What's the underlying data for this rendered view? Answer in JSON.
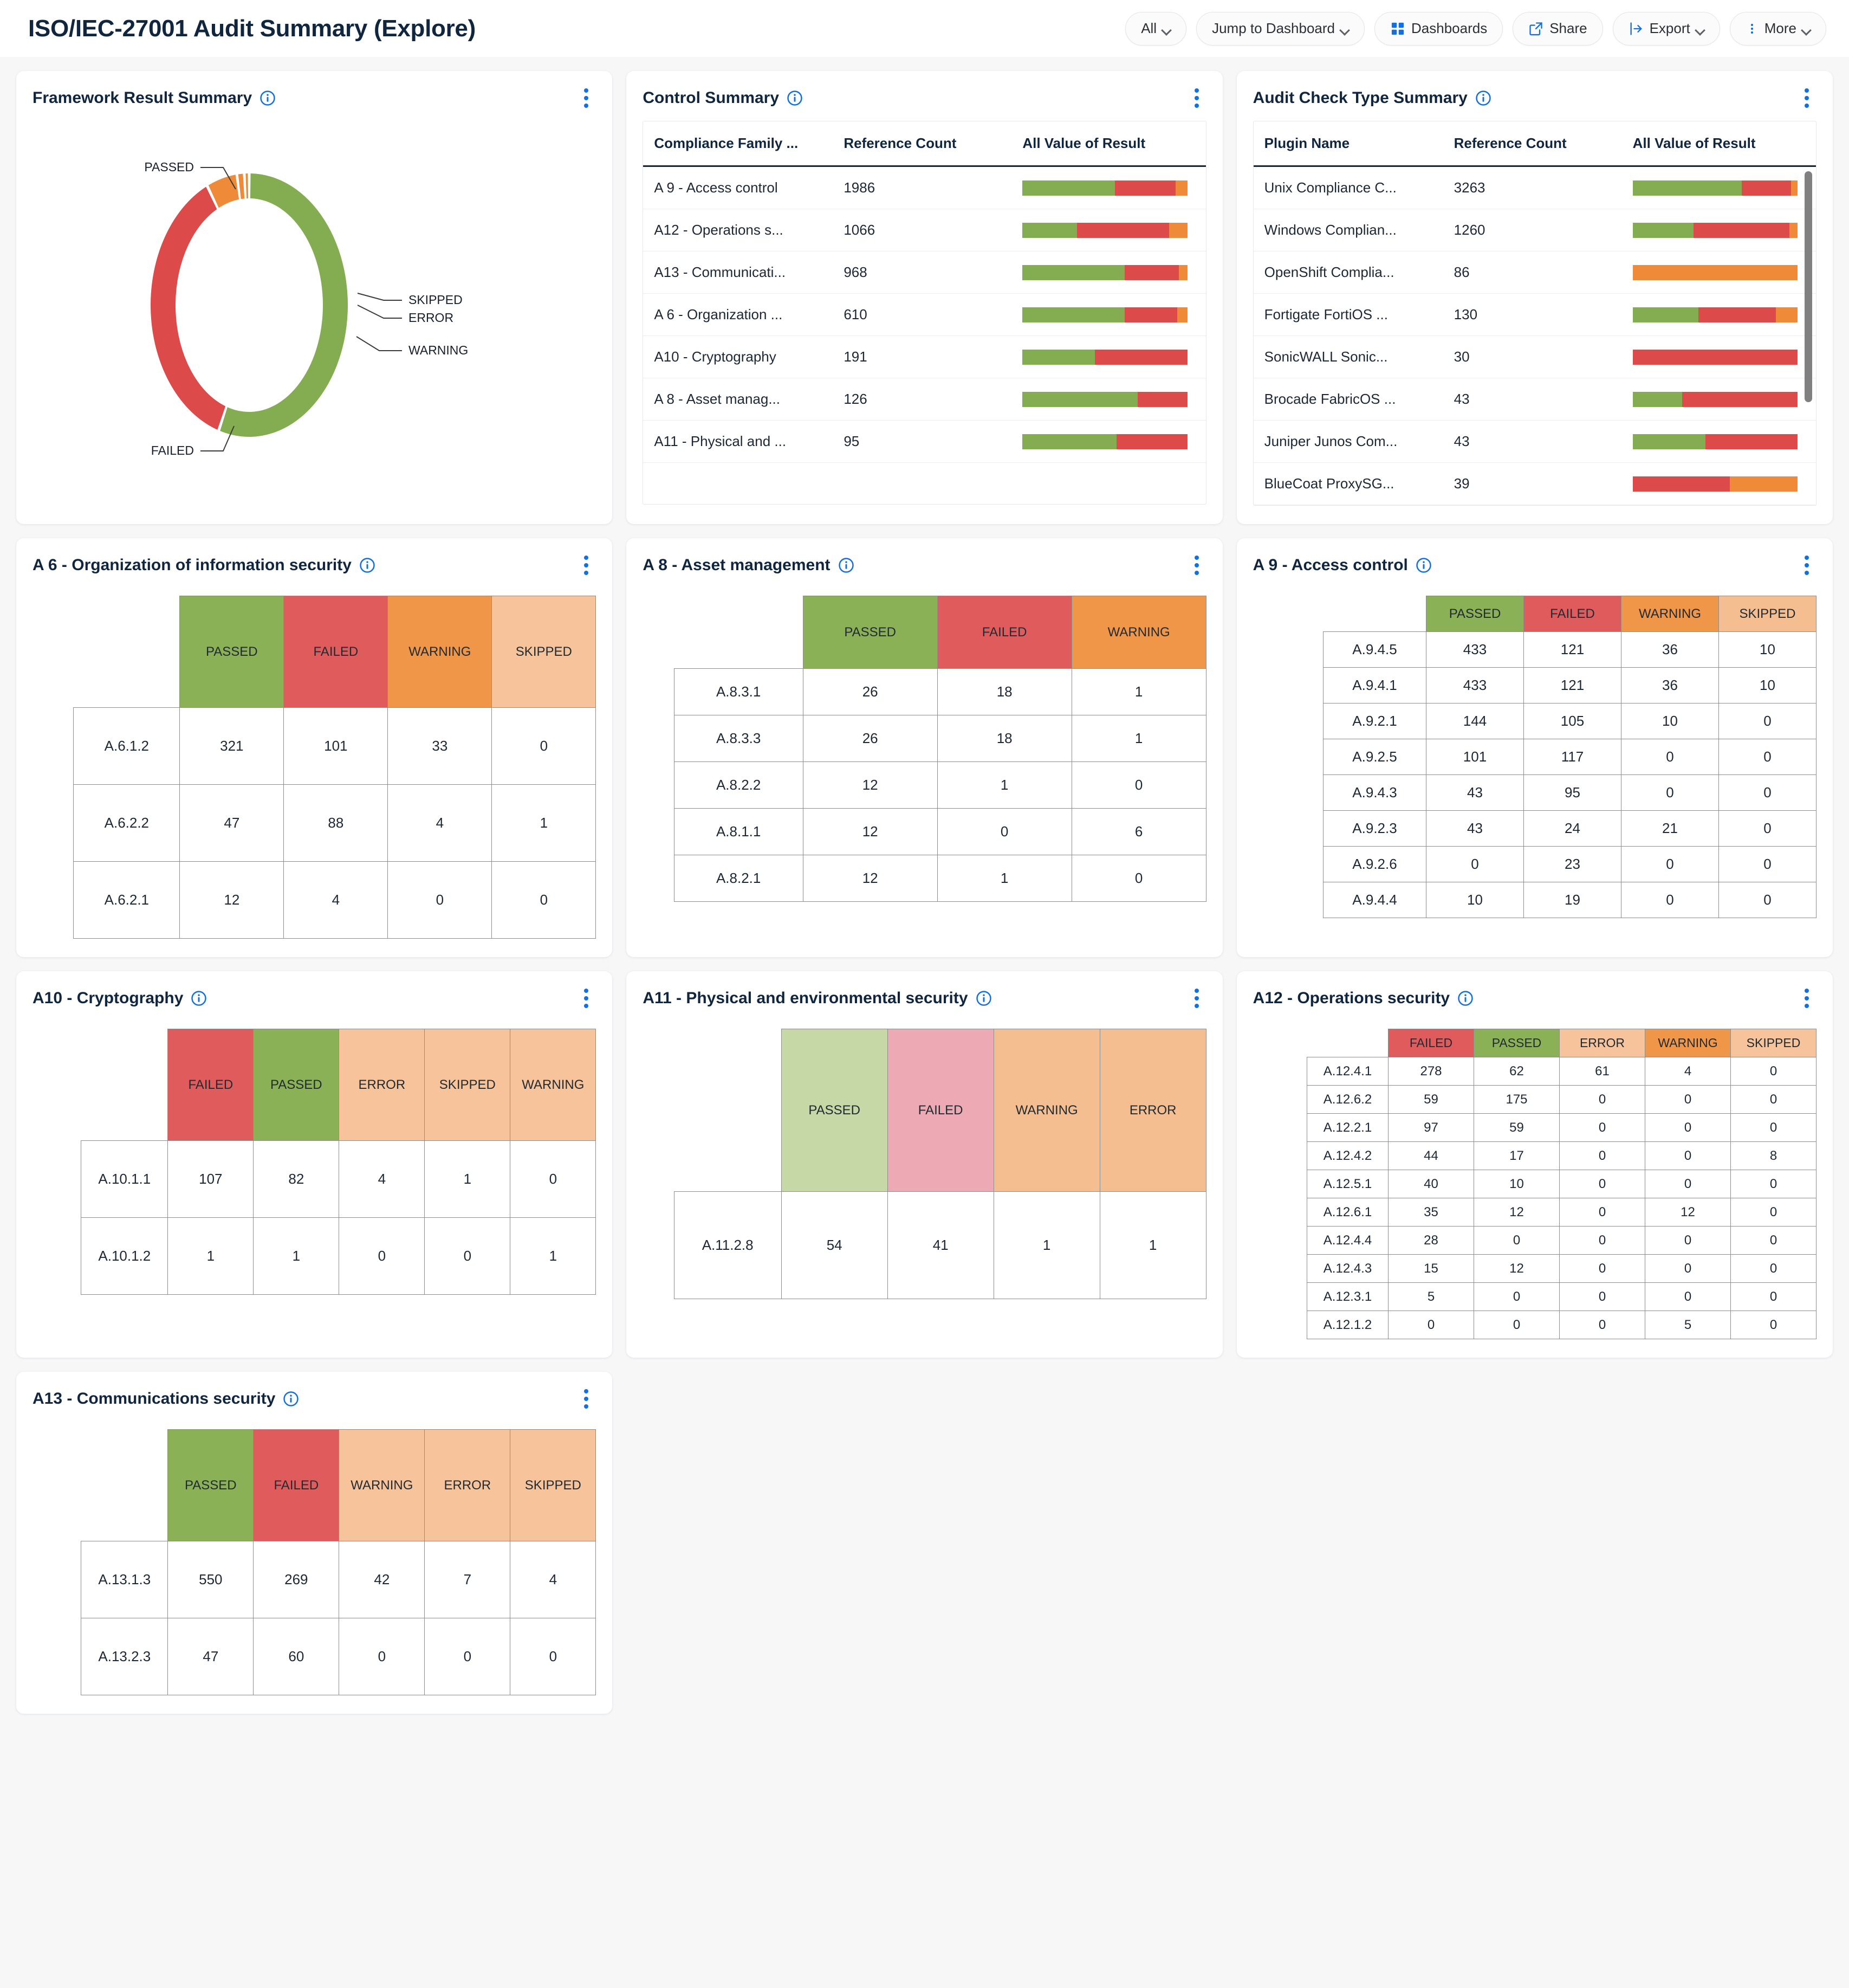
{
  "header": {
    "title": "ISO/IEC-27001 Audit Summary (Explore)",
    "buttons": [
      {
        "label": "All",
        "icon": "",
        "caret": true,
        "name": "filter-all-button"
      },
      {
        "label": "Jump to Dashboard",
        "icon": "",
        "caret": true,
        "name": "jump-to-dashboard-button"
      },
      {
        "label": "Dashboards",
        "icon": "grid-icon",
        "caret": false,
        "name": "dashboards-button"
      },
      {
        "label": "Share",
        "icon": "share-icon",
        "caret": false,
        "name": "share-button"
      },
      {
        "label": "Export",
        "icon": "export-icon",
        "caret": true,
        "name": "export-button"
      },
      {
        "label": "More",
        "icon": "kebab-icon",
        "caret": true,
        "name": "more-button"
      }
    ]
  },
  "colors": {
    "passed": "#84ad51",
    "failed": "#dc4a4a",
    "warning": "#ef8b38",
    "skipped": "#f7c39a",
    "error": "#f7c39a",
    "accent": "#1271e0",
    "title": "#10263f"
  },
  "cards": {
    "framework": {
      "title": "Framework Result Summary"
    },
    "control": {
      "title": "Control Summary"
    },
    "audit": {
      "title": "Audit Check Type Summary"
    },
    "a6": {
      "title": "A 6 - Organization of information security"
    },
    "a8": {
      "title": "A 8 - Asset management"
    },
    "a9": {
      "title": "A 9 - Access control"
    },
    "a10": {
      "title": "A10 - Cryptography"
    },
    "a11": {
      "title": "A11 - Physical and environmental security"
    },
    "a12": {
      "title": "A12 - Operations security"
    },
    "a13": {
      "title": "A13 - Communications security"
    }
  },
  "chart_data": [
    {
      "id": "framework_result_summary",
      "type": "pie",
      "title": "Framework Result Summary",
      "subtype": "donut",
      "labels": [
        "PASSED",
        "FAILED",
        "WARNING",
        "ERROR",
        "SKIPPED"
      ],
      "values": [
        55.0,
        38.0,
        5.0,
        1.2,
        0.8
      ],
      "unit": "percent",
      "colors": [
        "#84ad51",
        "#dc4a4a",
        "#ef8b38",
        "#ef8b38",
        "#ef8b38"
      ],
      "legend": "callout-labels",
      "grid": false
    },
    {
      "id": "control_summary",
      "type": "table",
      "title": "Control Summary",
      "columns": [
        "Compliance Family ...",
        "Reference Count",
        "All Value of Result"
      ],
      "rows": [
        {
          "name": "A 9 - Access control",
          "count": "1986",
          "bar": [
            {
              "k": "pass",
              "w": 56
            },
            {
              "k": "fail",
              "w": 37
            },
            {
              "k": "warn",
              "w": 7
            }
          ]
        },
        {
          "name": "A12 - Operations s...",
          "count": "1066",
          "bar": [
            {
              "k": "pass",
              "w": 33
            },
            {
              "k": "fail",
              "w": 56
            },
            {
              "k": "warn",
              "w": 11
            }
          ]
        },
        {
          "name": "A13 - Communicati...",
          "count": "968",
          "bar": [
            {
              "k": "pass",
              "w": 62
            },
            {
              "k": "fail",
              "w": 33
            },
            {
              "k": "warn",
              "w": 5
            }
          ]
        },
        {
          "name": "A 6 - Organization ...",
          "count": "610",
          "bar": [
            {
              "k": "pass",
              "w": 62
            },
            {
              "k": "fail",
              "w": 32
            },
            {
              "k": "warn",
              "w": 6
            }
          ]
        },
        {
          "name": "A10 - Cryptography",
          "count": "191",
          "bar": [
            {
              "k": "pass",
              "w": 44
            },
            {
              "k": "fail",
              "w": 56
            }
          ]
        },
        {
          "name": "A 8 - Asset manag...",
          "count": "126",
          "bar": [
            {
              "k": "pass",
              "w": 70
            },
            {
              "k": "fail",
              "w": 30
            }
          ]
        },
        {
          "name": "A11 - Physical and ...",
          "count": "95",
          "bar": [
            {
              "k": "pass",
              "w": 57
            },
            {
              "k": "fail",
              "w": 43
            }
          ]
        }
      ]
    },
    {
      "id": "audit_check_type_summary",
      "type": "table",
      "title": "Audit Check Type Summary",
      "columns": [
        "Plugin Name",
        "Reference Count",
        "All Value of Result"
      ],
      "scrollbar": true,
      "rows": [
        {
          "name": "Unix Compliance C...",
          "count": "3263",
          "bar": [
            {
              "k": "pass",
              "w": 66
            },
            {
              "k": "fail",
              "w": 30
            },
            {
              "k": "warn",
              "w": 4
            }
          ]
        },
        {
          "name": "Windows Complian...",
          "count": "1260",
          "bar": [
            {
              "k": "pass",
              "w": 37
            },
            {
              "k": "fail",
              "w": 58
            },
            {
              "k": "warn",
              "w": 5
            }
          ]
        },
        {
          "name": "OpenShift Complia...",
          "count": "86",
          "bar": [
            {
              "k": "warn",
              "w": 100
            }
          ]
        },
        {
          "name": "Fortigate FortiOS ...",
          "count": "130",
          "bar": [
            {
              "k": "pass",
              "w": 40
            },
            {
              "k": "fail",
              "w": 47
            },
            {
              "k": "warn",
              "w": 13
            }
          ]
        },
        {
          "name": "SonicWALL Sonic...",
          "count": "30",
          "bar": [
            {
              "k": "fail",
              "w": 100
            }
          ]
        },
        {
          "name": "Brocade FabricOS ...",
          "count": "43",
          "bar": [
            {
              "k": "pass",
              "w": 30
            },
            {
              "k": "fail",
              "w": 70
            }
          ]
        },
        {
          "name": "Juniper Junos Com...",
          "count": "43",
          "bar": [
            {
              "k": "pass",
              "w": 44
            },
            {
              "k": "fail",
              "w": 56
            }
          ]
        },
        {
          "name": "BlueCoat ProxySG...",
          "count": "39",
          "bar": [
            {
              "k": "fail",
              "w": 59
            },
            {
              "k": "warn",
              "w": 41
            }
          ]
        }
      ]
    },
    {
      "id": "a6_organization_of_information_security",
      "type": "heatmap",
      "title": "A 6 - Organization of information security",
      "columns": [
        "PASSED",
        "FAILED",
        "WARNING",
        "SKIPPED"
      ],
      "column_styles": [
        "h-pass",
        "h-fail",
        "h-warn",
        "h-skip"
      ],
      "rows": [
        "A.6.1.2",
        "A.6.2.2",
        "A.6.2.1"
      ],
      "values": [
        [
          321,
          101,
          33,
          0
        ],
        [
          47,
          88,
          4,
          1
        ],
        [
          12,
          4,
          0,
          0
        ]
      ],
      "density": "roomy"
    },
    {
      "id": "a8_asset_management",
      "type": "heatmap",
      "title": "A 8 - Asset management",
      "columns": [
        "PASSED",
        "FAILED",
        "WARNING"
      ],
      "column_styles": [
        "h-pass",
        "h-fail",
        "h-warn"
      ],
      "rows": [
        "A.8.3.1",
        "A.8.3.3",
        "A.8.2.2",
        "A.8.1.1",
        "A.8.2.1"
      ],
      "values": [
        [
          26,
          18,
          1
        ],
        [
          26,
          18,
          1
        ],
        [
          12,
          1,
          0
        ],
        [
          12,
          0,
          6
        ],
        [
          12,
          1,
          0
        ]
      ],
      "density": "normal"
    },
    {
      "id": "a9_access_control",
      "type": "heatmap",
      "title": "A 9 - Access control",
      "columns": [
        "PASSED",
        "FAILED",
        "WARNING",
        "SKIPPED"
      ],
      "column_styles": [
        "h-pass",
        "h-fail",
        "h-warn",
        "h-warn-soft"
      ],
      "rows": [
        "A.9.4.5",
        "A.9.4.1",
        "A.9.2.1",
        "A.9.2.5",
        "A.9.4.3",
        "A.9.2.3",
        "A.9.2.6",
        "A.9.4.4"
      ],
      "values": [
        [
          433,
          121,
          36,
          10
        ],
        [
          433,
          121,
          36,
          10
        ],
        [
          144,
          105,
          10,
          0
        ],
        [
          101,
          117,
          0,
          0
        ],
        [
          43,
          95,
          0,
          0
        ],
        [
          43,
          24,
          21,
          0
        ],
        [
          0,
          23,
          0,
          0
        ],
        [
          10,
          19,
          0,
          0
        ]
      ],
      "density": "compact"
    },
    {
      "id": "a10_cryptography",
      "type": "heatmap",
      "title": "A10 - Cryptography",
      "columns": [
        "FAILED",
        "PASSED",
        "ERROR",
        "SKIPPED",
        "WARNING"
      ],
      "column_styles": [
        "h-fail",
        "h-pass",
        "h-lite",
        "h-lite",
        "h-lite"
      ],
      "rows": [
        "A.10.1.1",
        "A.10.1.2"
      ],
      "values": [
        [
          107,
          82,
          4,
          1,
          0
        ],
        [
          1,
          1,
          0,
          0,
          1
        ]
      ],
      "density": "roomy"
    },
    {
      "id": "a11_physical_and_environmental_security",
      "type": "heatmap",
      "title": "A11 - Physical and environmental security",
      "columns": [
        "PASSED",
        "FAILED",
        "WARNING",
        "ERROR"
      ],
      "column_styles": [
        "h-pass-soft",
        "h-fail-soft",
        "h-warn-soft",
        "h-warn-soft"
      ],
      "rows": [
        "A.11.2.8"
      ],
      "values": [
        [
          54,
          41,
          1,
          1
        ]
      ],
      "density": "xroomy"
    },
    {
      "id": "a12_operations_security",
      "type": "heatmap",
      "title": "A12 - Operations security",
      "columns": [
        "FAILED",
        "PASSED",
        "ERROR",
        "WARNING",
        "SKIPPED"
      ],
      "column_styles": [
        "h-fail",
        "h-pass",
        "h-skip",
        "h-warn",
        "h-skip"
      ],
      "rows": [
        "A.12.4.1",
        "A.12.6.2",
        "A.12.2.1",
        "A.12.4.2",
        "A.12.5.1",
        "A.12.6.1",
        "A.12.4.4",
        "A.12.4.3",
        "A.12.3.1",
        "A.12.1.2"
      ],
      "values": [
        [
          278,
          62,
          61,
          4,
          0
        ],
        [
          59,
          175,
          0,
          0,
          0
        ],
        [
          97,
          59,
          0,
          0,
          0
        ],
        [
          44,
          17,
          0,
          0,
          8
        ],
        [
          40,
          10,
          0,
          0,
          0
        ],
        [
          35,
          12,
          0,
          12,
          0
        ],
        [
          28,
          0,
          0,
          0,
          0
        ],
        [
          15,
          12,
          0,
          0,
          0
        ],
        [
          5,
          0,
          0,
          0,
          0
        ],
        [
          0,
          0,
          0,
          5,
          0
        ]
      ],
      "density": "xcompact"
    },
    {
      "id": "a13_communications_security",
      "type": "heatmap",
      "title": "A13 - Communications security",
      "columns": [
        "PASSED",
        "FAILED",
        "WARNING",
        "ERROR",
        "SKIPPED"
      ],
      "column_styles": [
        "h-pass",
        "h-fail",
        "h-lite",
        "h-lite",
        "h-lite"
      ],
      "rows": [
        "A.13.1.3",
        "A.13.2.3"
      ],
      "values": [
        [
          550,
          269,
          42,
          7,
          4
        ],
        [
          47,
          60,
          0,
          0,
          0
        ]
      ],
      "density": "roomy"
    }
  ]
}
